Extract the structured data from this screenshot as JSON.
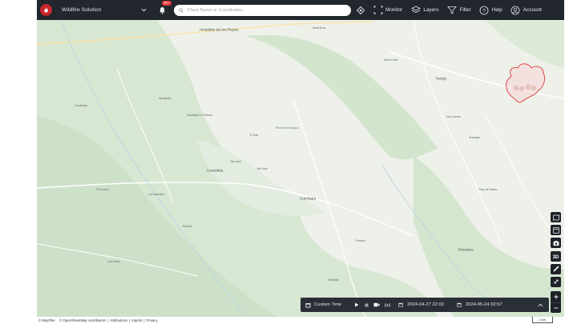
{
  "header": {
    "brand": "Wildfire Solution",
    "notifications_badge": "10+",
    "search_placeholder": "Place Name or Coordinates",
    "nav": [
      {
        "key": "monitor",
        "label": "Monitor",
        "icon": "monitor-frame-icon"
      },
      {
        "key": "layers",
        "label": "Layers",
        "icon": "layers-icon"
      },
      {
        "key": "filter",
        "label": "Filter",
        "icon": "filter-icon"
      },
      {
        "key": "help",
        "label": "Help",
        "icon": "help-icon"
      },
      {
        "key": "account",
        "label": "Account",
        "icon": "account-icon"
      }
    ]
  },
  "map": {
    "places": [
      {
        "name": "Amatitlán de los Reyes",
        "kind": "city"
      },
      {
        "name": "Yanga",
        "kind": "city"
      },
      {
        "name": "Cordobita",
        "kind": "city"
      },
      {
        "name": "Cuichapa",
        "kind": "city"
      },
      {
        "name": "Omealca",
        "kind": "city"
      },
      {
        "name": "Guadalupe La Patrona",
        "kind": "town"
      },
      {
        "name": "El Tejar",
        "kind": "town"
      },
      {
        "name": "Atoyaquillo",
        "kind": "town"
      },
      {
        "name": "San Juan",
        "kind": "town"
      },
      {
        "name": "La Candelaria",
        "kind": "town"
      },
      {
        "name": "Potrerillo",
        "kind": "town"
      },
      {
        "name": "El Porvenir",
        "kind": "town"
      },
      {
        "name": "San José",
        "kind": "town"
      },
      {
        "name": "Tezonapa",
        "kind": "town"
      },
      {
        "name": "Cuautlapan",
        "kind": "town"
      },
      {
        "name": "San Lorenzo",
        "kind": "town"
      },
      {
        "name": "Paso del Macho",
        "kind": "town"
      },
      {
        "name": "Presidio",
        "kind": "town"
      },
      {
        "name": "Las Lomas",
        "kind": "town"
      },
      {
        "name": "El Mirador",
        "kind": "town"
      },
      {
        "name": "Buena Vista",
        "kind": "town"
      },
      {
        "name": "Santa Rosa",
        "kind": "town"
      },
      {
        "name": "Reserva Ecológica",
        "kind": "park"
      }
    ]
  },
  "timeline": {
    "range_label": "Custom Time",
    "start": "2024-04-27 22:02",
    "end": "2024-05-24 02:57"
  },
  "attribution": {
    "maptiler": "© MapTiler",
    "osm": "© OpenStreetMap contributors",
    "attributions": "Attributions",
    "imprint": "Imprint",
    "privacy": "Privacy"
  },
  "scale_label": "2 km",
  "colors": {
    "topbar": "#22262d",
    "fire_perimeter": "#d93a3a",
    "brand_red": "#c8262d",
    "forest": "#cfe2cc"
  }
}
